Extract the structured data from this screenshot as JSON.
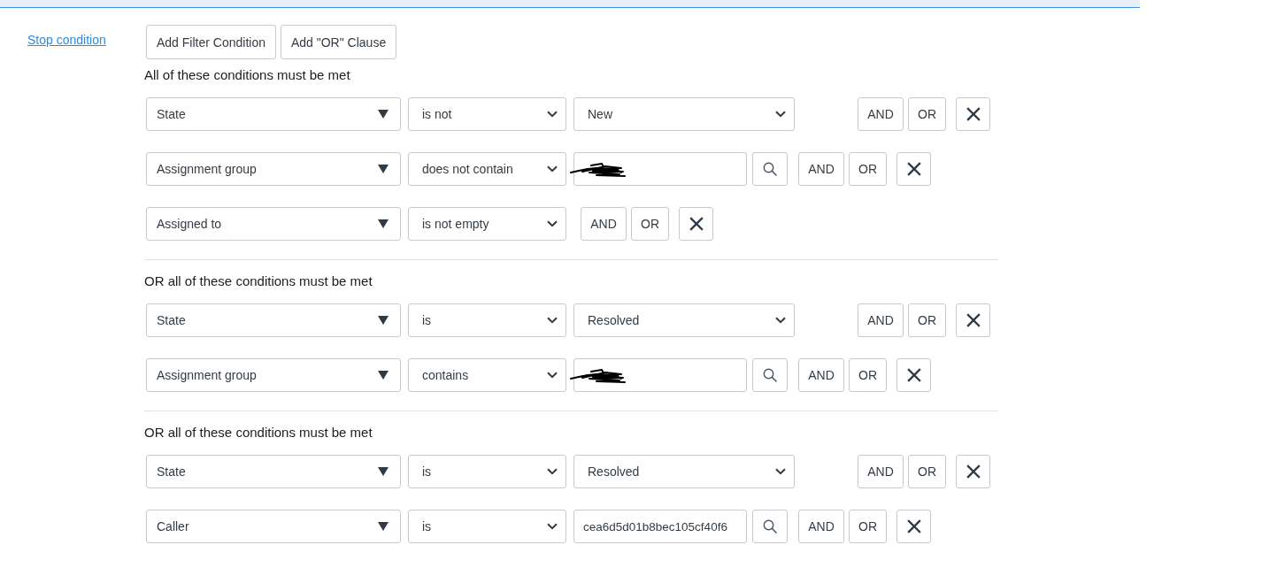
{
  "stop_condition_link": "Stop condition",
  "toolbar_buttons": [
    "Add Filter Condition",
    "Add \"OR\" Clause"
  ],
  "groups": [
    {
      "heading": "All of these conditions must be met",
      "conditions": [
        {
          "kind": "choice",
          "field": "State",
          "operator": "is not",
          "value": "New",
          "and_button": "AND",
          "or_button": "OR"
        },
        {
          "kind": "reference",
          "field": "Assignment group",
          "operator": "does not contain",
          "redacted": true,
          "and_button": "AND",
          "or_button": "OR"
        },
        {
          "kind": "no_value",
          "field": "Assigned to",
          "operator": "is not empty",
          "and_button": "AND",
          "or_button": "OR"
        }
      ]
    },
    {
      "heading": "OR all of these conditions must be met",
      "conditions": [
        {
          "kind": "choice",
          "field": "State",
          "operator": "is",
          "value": "Resolved",
          "and_button": "AND",
          "or_button": "OR"
        },
        {
          "kind": "reference",
          "field": "Assignment group",
          "operator": "contains",
          "redacted": true,
          "and_button": "AND",
          "or_button": "OR"
        }
      ]
    },
    {
      "heading": "OR all of these conditions must be met",
      "conditions": [
        {
          "kind": "choice",
          "field": "State",
          "operator": "is",
          "value": "Resolved",
          "and_button": "AND",
          "or_button": "OR"
        },
        {
          "kind": "reference",
          "field": "Caller",
          "operator": "is",
          "value": "cea6d5d01b8bec105cf40f6",
          "redacted": false,
          "and_button": "AND",
          "or_button": "OR"
        }
      ]
    }
  ]
}
